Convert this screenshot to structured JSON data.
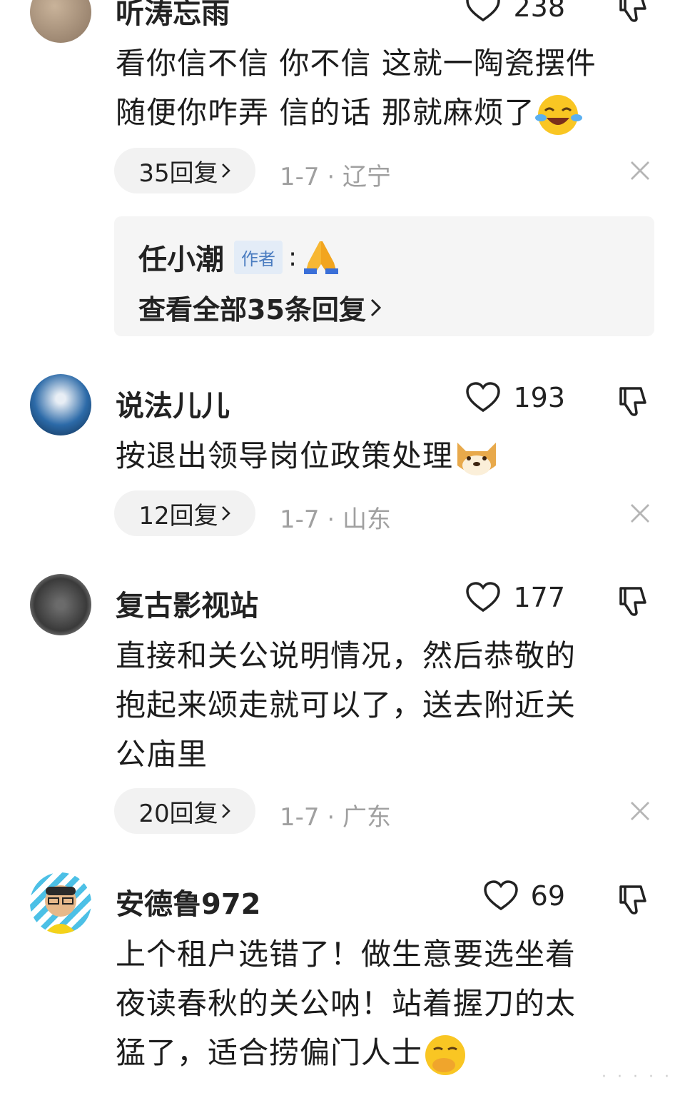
{
  "comments": [
    {
      "username": "听涛忘雨",
      "likes": "238",
      "text_lines": [
        "看你信不信 你不信 这就一陶瓷摆件",
        "随便你咋弄 信的话 那就麻烦了"
      ],
      "emoji": "laughing-crying-emoji",
      "replies_label": "35回复",
      "meta": "1-7 · 辽宁",
      "sub_reply": {
        "name": "任小潮",
        "badge": "作者",
        "colon": ":",
        "emoji": "praying-hands-emoji",
        "view_all": "查看全部35条回复"
      }
    },
    {
      "username": "说法儿儿",
      "likes": "193",
      "text_lines": [
        "按退出领导岗位政策处理"
      ],
      "emoji": "doge-emoji",
      "replies_label": "12回复",
      "meta": "1-7 · 山东"
    },
    {
      "username": "复古影视站",
      "likes": "177",
      "text_lines": [
        "直接和关公说明情况，然后恭敬的",
        "抱起来颂走就可以了，送去附近关",
        "公庙里"
      ],
      "replies_label": "20回复",
      "meta": "1-7 · 广东"
    },
    {
      "username": "安德鲁972",
      "likes": "69",
      "text_lines": [
        "上个租户选错了！做生意要选坐着",
        "夜读春秋的关公呐！站着握刀的太",
        "猛了，适合捞偏门人士"
      ],
      "emoji": "hand-over-mouth-emoji"
    }
  ],
  "colors": {
    "pill_bg": "#f2f2f2",
    "meta_text": "#a0a0a0",
    "author_badge_bg": "#e3ecf7",
    "author_badge_text": "#4a7cc0"
  }
}
